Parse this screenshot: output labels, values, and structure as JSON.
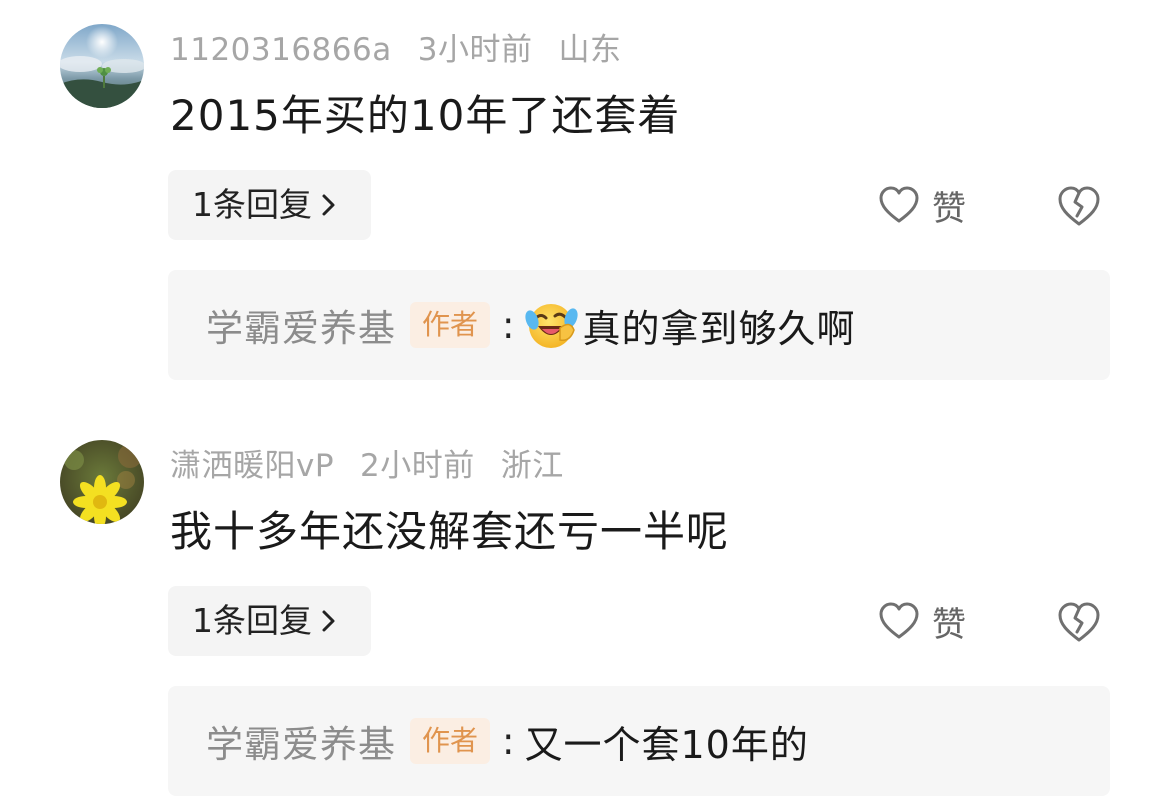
{
  "comments": [
    {
      "username": "1120316866a",
      "time": "3小时前",
      "location": "山东",
      "text": "2015年买的10年了还套着",
      "reply_count": "1条回复",
      "like_label": "赞",
      "reply": {
        "author": "学霸爱养基",
        "badge": "作者",
        "colon": ":",
        "emoji": "laughing-crying-emoji",
        "text": "真的拿到够久啊"
      }
    },
    {
      "username": "潇洒暖阳vP",
      "time": "2小时前",
      "location": "浙江",
      "text": "我十多年还没解套还亏一半呢",
      "reply_count": "1条回复",
      "like_label": "赞",
      "reply": {
        "author": "学霸爱养基",
        "badge": "作者",
        "colon": ":",
        "text": "又一个套10年的"
      }
    }
  ],
  "colors": {
    "meta_text": "#a6a6a6",
    "author_badge_text": "#e0944e",
    "author_badge_bg": "#fbeee3",
    "reply_box_bg": "#f6f6f6"
  }
}
